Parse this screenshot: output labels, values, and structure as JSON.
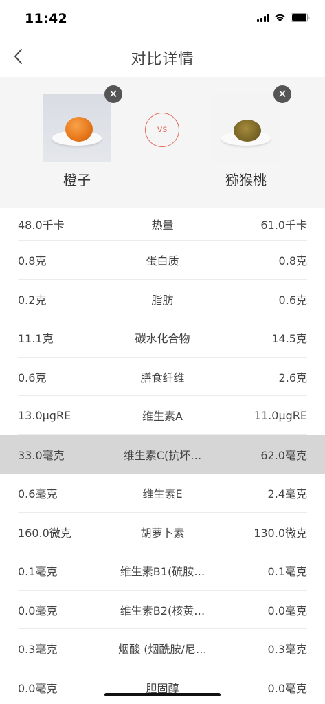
{
  "status_bar": {
    "time": "11:42"
  },
  "nav": {
    "title": "对比详情"
  },
  "compare": {
    "left_food": "橙子",
    "right_food": "猕猴桃",
    "vs_label": "vs",
    "remove_symbol": "✕"
  },
  "nutrients": [
    {
      "name": "热量",
      "left": "48.0千卡",
      "right": "61.0千卡"
    },
    {
      "name": "蛋白质",
      "left": "0.8克",
      "right": "0.8克"
    },
    {
      "name": "脂肪",
      "left": "0.2克",
      "right": "0.6克"
    },
    {
      "name": "碳水化合物",
      "left": "11.1克",
      "right": "14.5克"
    },
    {
      "name": "膳食纤维",
      "left": "0.6克",
      "right": "2.6克"
    },
    {
      "name": "维生素A",
      "left": "13.0μgRE",
      "right": "11.0μgRE"
    },
    {
      "name": "维生素C(抗坏…",
      "left": "33.0毫克",
      "right": "62.0毫克"
    },
    {
      "name": "维生素E",
      "left": "0.6毫克",
      "right": "2.4毫克"
    },
    {
      "name": "胡萝卜素",
      "left": "160.0微克",
      "right": "130.0微克"
    },
    {
      "name": "维生素B1(硫胺…",
      "left": "0.1毫克",
      "right": "0.1毫克"
    },
    {
      "name": "维生素B2(核黄…",
      "left": "0.0毫克",
      "right": "0.0毫克"
    },
    {
      "name": "烟酸 (烟酰胺/尼…",
      "left": "0.3毫克",
      "right": "0.3毫克"
    },
    {
      "name": "胆固醇",
      "left": "0.0毫克",
      "right": "0.0毫克"
    }
  ]
}
